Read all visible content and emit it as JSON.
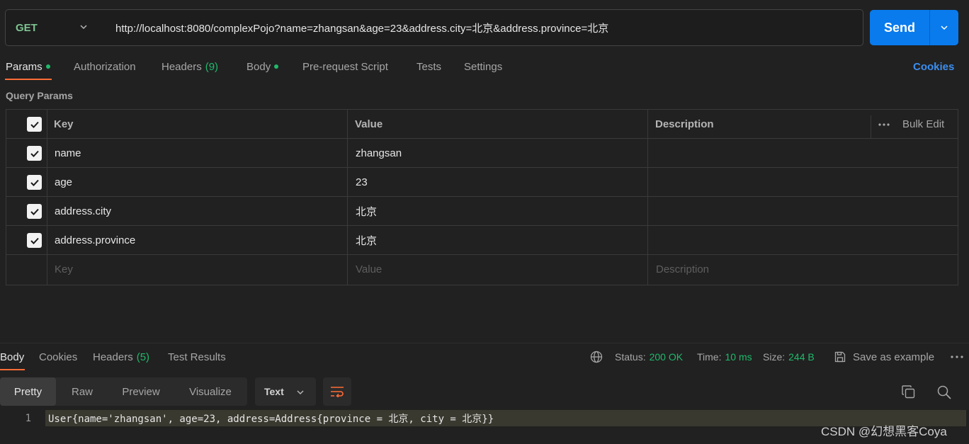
{
  "request": {
    "method": "GET",
    "url": "http://localhost:8080/complexPojo?name=zhangsan&age=23&address.city=北京&address.province=北京",
    "send_label": "Send"
  },
  "request_tabs": {
    "params": "Params",
    "authorization": "Authorization",
    "headers": "Headers",
    "headers_count": "(9)",
    "body": "Body",
    "pre_request": "Pre-request Script",
    "tests": "Tests",
    "settings": "Settings",
    "cookies": "Cookies"
  },
  "query_params": {
    "title": "Query Params",
    "columns": {
      "key": "Key",
      "value": "Value",
      "description": "Description",
      "bulk_edit": "Bulk Edit"
    },
    "rows": [
      {
        "key": "name",
        "value": "zhangsan",
        "checked": true
      },
      {
        "key": "age",
        "value": "23",
        "checked": true
      },
      {
        "key": "address.city",
        "value": "北京",
        "checked": true
      },
      {
        "key": "address.province",
        "value": "北京",
        "checked": true
      }
    ],
    "placeholders": {
      "key": "Key",
      "value": "Value",
      "description": "Description"
    }
  },
  "response": {
    "tabs": {
      "body": "Body",
      "cookies": "Cookies",
      "headers": "Headers",
      "headers_count": "(5)",
      "test_results": "Test Results"
    },
    "status_label": "Status:",
    "status_value": "200 OK",
    "time_label": "Time:",
    "time_value": "10 ms",
    "size_label": "Size:",
    "size_value": "244 B",
    "save_example": "Save as example",
    "views": {
      "pretty": "Pretty",
      "raw": "Raw",
      "preview": "Preview",
      "visualize": "Visualize"
    },
    "format": "Text",
    "line_number": "1",
    "body_text": "User{name='zhangsan', age=23, address=Address{province = 北京, city = 北京}}"
  },
  "watermark": "CSDN @幻想黑客Coya",
  "colors": {
    "accent": "#ff6c37",
    "send": "#097bed",
    "success": "#1fba6b",
    "link": "#3b8ef0"
  }
}
